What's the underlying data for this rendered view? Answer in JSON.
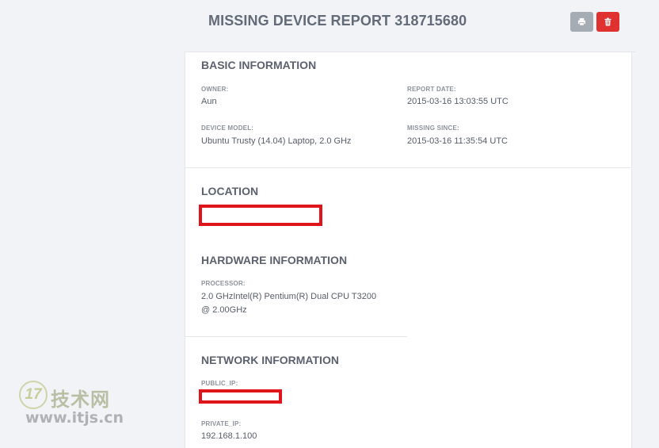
{
  "header": {
    "title": "MISSING DEVICE REPORT 318715680",
    "print_icon": "printer-icon",
    "delete_icon": "trash-icon",
    "colors": {
      "print": "#a6acb4",
      "delete": "#e03131"
    }
  },
  "basic_information": {
    "title": "BASIC INFORMATION",
    "owner_label": "OWNER:",
    "owner_value": "Aun",
    "report_date_label": "REPORT DATE:",
    "report_date_value": "2015-03-16 13:03:55 UTC",
    "device_model_label": "DEVICE MODEL:",
    "device_model_value": "Ubuntu Trusty (14.04) Laptop, 2.0 GHz",
    "missing_since_label": "MISSING SINCE:",
    "missing_since_value": "2015-03-16 11:35:54 UTC"
  },
  "location": {
    "title": "LOCATION"
  },
  "hardware_information": {
    "title": "HARDWARE INFORMATION",
    "processor_label": "PROCESSOR:",
    "processor_line1": "2.0 GHzIntel(R) Pentium(R) Dual CPU T3200",
    "processor_line2": "@ 2.00GHz"
  },
  "network_information": {
    "title": "NETWORK INFORMATION",
    "public_ip_label": "PUBLIC_IP:",
    "private_ip_label": "PRIVATE_IP:",
    "private_ip_value": "192.168.1.100"
  },
  "watermark": {
    "badge": "17",
    "cn_text": "技术网",
    "url": "www.itjs.cn"
  },
  "redaction_color": "#e0151c"
}
